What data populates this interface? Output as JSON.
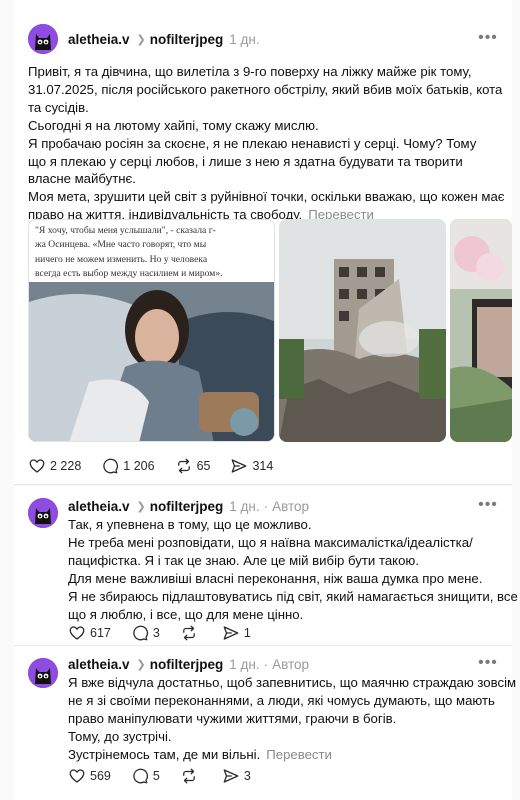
{
  "post": {
    "username": "aletheia.v",
    "topic": "nofilterjpeg",
    "time": "1 дн.",
    "lines": [
      "Привіт, я та дівчина, що вилетіла з 9-го поверху на ліжку майже рік тому,",
      "31.07.2025, після російського ракетного обстрілу, який вбив моїх батьків, кота",
      "та сусідів.",
      "Сьогодні я на лютому хайпі, тому скажу мислю.",
      "Я пробачаю росіян за скоєне, я не плекаю ненависті у серці. Чому? Тому",
      "що я плекаю у серці любов, і лише з нею я здатна будувати та творити",
      "власне майбутнє.",
      "Моя мета, зрушити цей світ з руйнівної точки, оскільки вважаю, що кожен має",
      "право на життя, індивідуальність та свободу."
    ],
    "translate": "Перевести",
    "quote_lines": [
      "\"Я хочу, чтобы меня услышали\", - сказала г-",
      "жа Осинцева. «Мне часто говорят, что мы",
      "ничего не можем изменить. Но у человека",
      "всегда есть выбор между насилием и миром»."
    ],
    "likes": "2 228",
    "replies": "1 206",
    "reposts": "65",
    "shares": "314"
  },
  "reply1": {
    "username": "aletheia.v",
    "topic": "nofilterjpeg",
    "time": "1 дн.",
    "author": "Автор",
    "lines": [
      "Так, я упевнена в тому, що це можливо.",
      "Не треба мені розповідати, що я наївна максималістка/ідеалістка/",
      "пацифістка. Я і так це знаю. Але це мій вибір бути такою.",
      "Для мене важливіші власні переконання, ніж ваша думка про мене.",
      "Я не збираюсь підлаштовуватись під світ, який намагається знищити, все",
      "що я люблю, і все, що для мене цінно."
    ],
    "likes": "617",
    "replies": "3",
    "shares": "1"
  },
  "reply2": {
    "username": "aletheia.v",
    "topic": "nofilterjpeg",
    "time": "1 дн.",
    "author": "Автор",
    "lines": [
      "Я вже відчула достатньо, щоб запевнитись, що маячню страждаю зовсім",
      "не я зі своїми переконаннями, а люди, які чомусь думають, що мають",
      "право маніпулювати чужими життями, граючи в богів.",
      "Тому, до зустрічі.",
      "Зустрінемось там, де ми вільні."
    ],
    "translate": "Перевести",
    "likes": "569",
    "replies": "5",
    "shares": "3"
  },
  "colors": {
    "avatar_bg": "#8e4ce0",
    "muted": "#9a9a9a",
    "text": "#101010"
  },
  "icons": [
    "cat-avatar-icon",
    "chevron-right-icon",
    "more-icon",
    "heart-icon",
    "comment-icon",
    "repost-icon",
    "share-icon"
  ]
}
